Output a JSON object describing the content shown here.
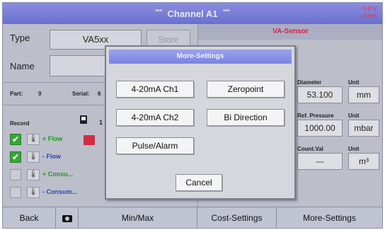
{
  "header": {
    "title": "Channel A1",
    "stars": "***",
    "status_voltage": "~ 0.0 V",
    "status_current": "~ 0 mA"
  },
  "left": {
    "type_label": "Type",
    "type_value": "VA5xx",
    "store_label": "Store",
    "name_label": "Name",
    "part_label": "Part:",
    "part_value": "0",
    "serial_label": "Serial:",
    "serial_partial": "6",
    "record_label": "Record",
    "record_partial": "1",
    "records": [
      {
        "checked": true,
        "label": "+ Flow",
        "color": "#1a9a1a"
      },
      {
        "checked": true,
        "label": "- Flow",
        "color": "#1f3fb8"
      },
      {
        "checked": false,
        "label": "+ Consu...",
        "color": "#1a9a1a"
      },
      {
        "checked": false,
        "label": "- Consum...",
        "color": "#1f3fb8"
      }
    ]
  },
  "right": {
    "sensor_title": "VA-Sensor",
    "diameter_label": "Diameter",
    "diameter_value": "53.100",
    "diameter_unit_label": "Unit",
    "diameter_unit": "mm",
    "ref_pressure_label": "Ref. Pressure",
    "ref_pressure_value": "1000.00",
    "ref_pressure_unit_label": "Unit",
    "ref_pressure_unit": "mbar",
    "count_label": "Count.Val",
    "count_value": "---",
    "count_unit_label": "Unit",
    "count_unit": "m³"
  },
  "footer": {
    "back": "Back",
    "camera_icon": "camera-icon",
    "minmax": "Min/Max",
    "cost_settings": "Cost-Settings",
    "more_settings": "More-Settings"
  },
  "modal": {
    "title": "More-Settings",
    "btn_420_ch1": "4-20mA Ch1",
    "btn_zeropoint": "Zeropoint",
    "btn_420_ch2": "4-20mA Ch2",
    "btn_bidirection": "Bi Direction",
    "btn_pulse": "Pulse/Alarm",
    "btn_cancel": "Cancel"
  },
  "colors": {
    "header": "#7a7fd8",
    "status_red": "#ff2a2a",
    "sensor_title": "#d21a3a",
    "check_green": "#2ab02a"
  }
}
